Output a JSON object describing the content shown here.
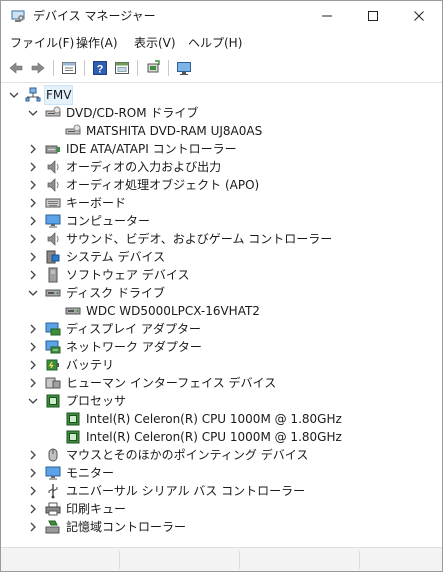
{
  "window": {
    "title": "デバイス マネージャー",
    "app_icon": "device-manager-icon"
  },
  "caption_buttons": {
    "minimize": "minimize-icon",
    "maximize": "maximize-icon",
    "close": "close-icon"
  },
  "menu": [
    "ファイル(F)",
    "操作(A)",
    "表示(V)",
    "ヘルプ(H)"
  ],
  "toolbar": [
    "back-arrow-icon",
    "forward-arrow-icon",
    "properties-icon",
    "help-icon",
    "view-icon",
    "update-driver-icon",
    "monitor-scan-icon"
  ],
  "tree": {
    "root": "FMV",
    "items": [
      {
        "label": "DVD/CD-ROM ドライブ",
        "expanded": true,
        "icon": "dvd-drive-icon",
        "children": [
          {
            "label": "MATSHITA DVD-RAM UJ8A0AS",
            "icon": "dvd-drive-icon"
          }
        ]
      },
      {
        "label": "IDE ATA/ATAPI コントローラー",
        "expanded": false,
        "icon": "ide-controller-icon"
      },
      {
        "label": "オーディオの入力および出力",
        "expanded": false,
        "icon": "speaker-icon"
      },
      {
        "label": "オーディオ処理オブジェクト (APO)",
        "expanded": false,
        "icon": "speaker-icon"
      },
      {
        "label": "キーボード",
        "expanded": false,
        "icon": "keyboard-icon"
      },
      {
        "label": "コンピューター",
        "expanded": false,
        "icon": "computer-icon"
      },
      {
        "label": "サウンド、ビデオ、およびゲーム コントローラー",
        "expanded": false,
        "icon": "speaker-icon"
      },
      {
        "label": "システム デバイス",
        "expanded": false,
        "icon": "system-device-icon"
      },
      {
        "label": "ソフトウェア デバイス",
        "expanded": false,
        "icon": "software-device-icon"
      },
      {
        "label": "ディスク ドライブ",
        "expanded": true,
        "icon": "disk-drive-icon",
        "children": [
          {
            "label": "WDC WD5000LPCX-16VHAT2",
            "icon": "disk-drive-icon"
          }
        ]
      },
      {
        "label": "ディスプレイ アダプター",
        "expanded": false,
        "icon": "display-adapter-icon"
      },
      {
        "label": "ネットワーク アダプター",
        "expanded": false,
        "icon": "network-adapter-icon"
      },
      {
        "label": "バッテリ",
        "expanded": false,
        "icon": "battery-icon"
      },
      {
        "label": "ヒューマン インターフェイス デバイス",
        "expanded": false,
        "icon": "hid-icon"
      },
      {
        "label": "プロセッサ",
        "expanded": true,
        "icon": "processor-icon",
        "children": [
          {
            "label": "Intel(R) Celeron(R) CPU 1000M @ 1.80GHz",
            "icon": "processor-icon"
          },
          {
            "label": "Intel(R) Celeron(R) CPU 1000M @ 1.80GHz",
            "icon": "processor-icon"
          }
        ]
      },
      {
        "label": "マウスとそのほかのポインティング デバイス",
        "expanded": false,
        "icon": "mouse-icon"
      },
      {
        "label": "モニター",
        "expanded": false,
        "icon": "monitor-icon"
      },
      {
        "label": "ユニバーサル シリアル バス コントローラー",
        "expanded": false,
        "icon": "usb-icon"
      },
      {
        "label": "印刷キュー",
        "expanded": false,
        "icon": "printer-icon"
      },
      {
        "label": "記憶域コントローラー",
        "expanded": false,
        "icon": "storage-controller-icon"
      }
    ]
  },
  "colors": {
    "selection": "#e5f1fb",
    "chevron": "#444444",
    "icon_blue": "#2b78d0",
    "icon_green": "#3c8f3c"
  }
}
